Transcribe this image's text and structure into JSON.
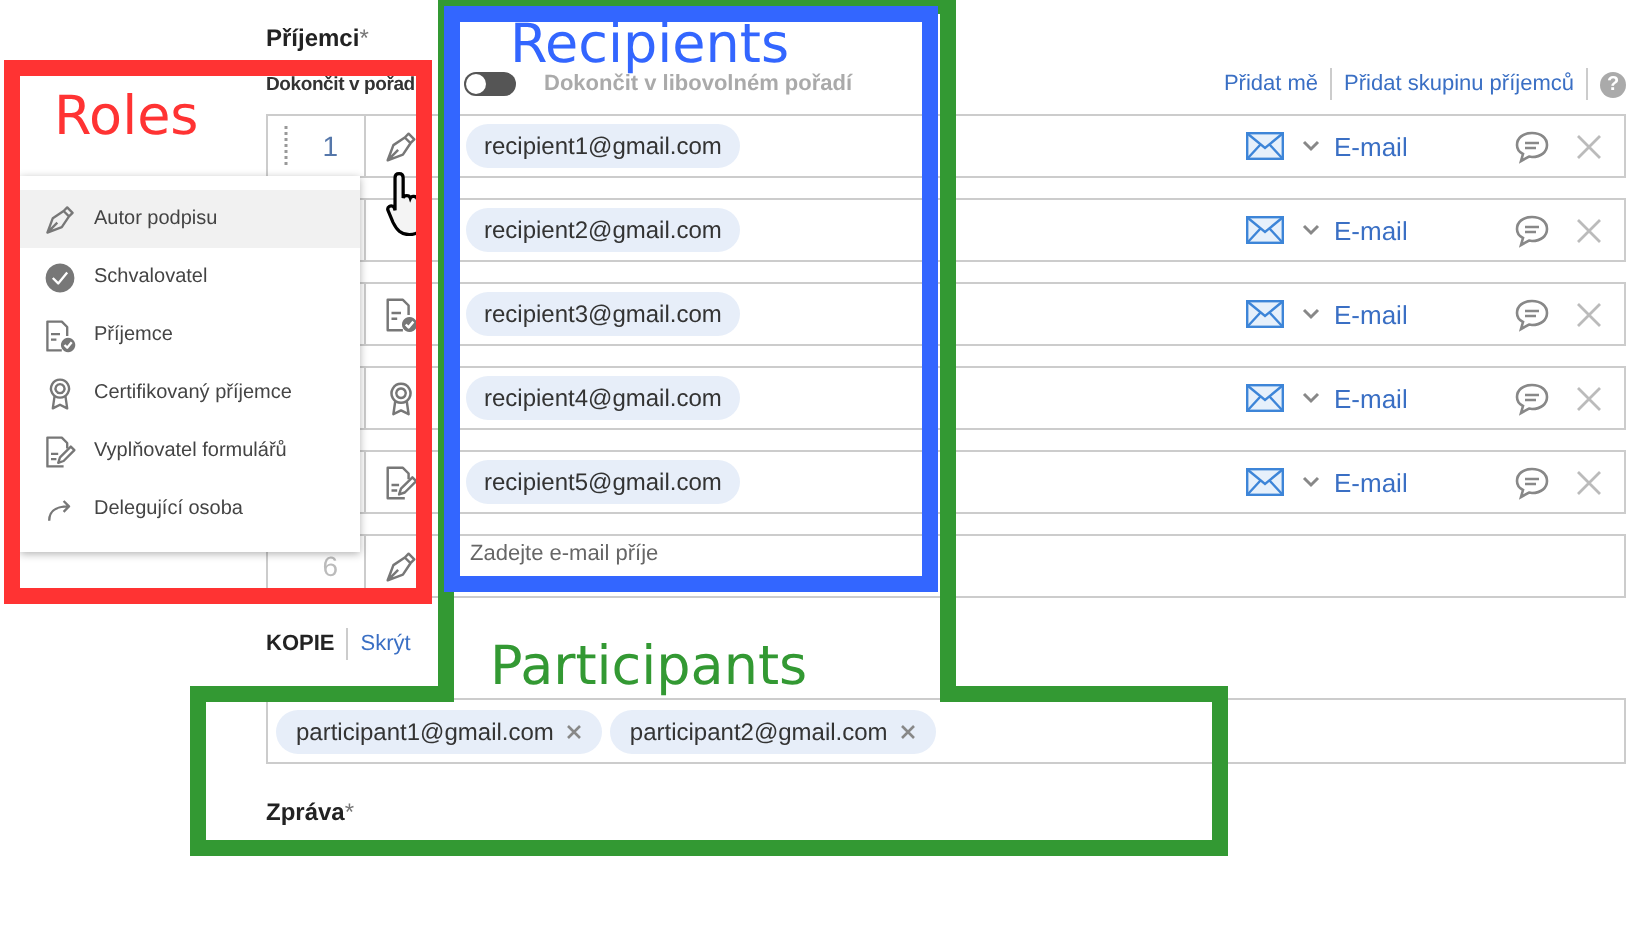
{
  "recipients": {
    "title": "Příjemci",
    "required_mark": "*",
    "order_label": "Dokončit v pořad",
    "order_toggle": {
      "on": false,
      "label": "Dokončit v libovolném pořadí"
    },
    "links": [
      "Přidat mě",
      "Přidat skupinu příjemců"
    ],
    "help": "?",
    "rows": [
      {
        "number": "1",
        "kind": "signer",
        "email": "recipient1@gmail.com",
        "delivery": "E-mail"
      },
      {
        "email": "recipient2@gmail.com",
        "delivery": "E-mail"
      },
      {
        "kind": "recipient",
        "email": "recipient3@gmail.com",
        "delivery": "E-mail"
      },
      {
        "kind": "certified",
        "email": "recipient4@gmail.com",
        "delivery": "E-mail"
      },
      {
        "kind": "form_filler",
        "email": "recipient5@gmail.com",
        "delivery": "E-mail"
      },
      {
        "number": "6",
        "kind": "signer",
        "placeholder": "Zadejte e-mail příje"
      }
    ]
  },
  "roles_menu": {
    "items": [
      {
        "kind": "signer",
        "label": "Autor podpisu",
        "selected": true
      },
      {
        "kind": "approver",
        "label": "Schvalovatel",
        "selected": false
      },
      {
        "kind": "recipient",
        "label": "Příjemce",
        "selected": false
      },
      {
        "kind": "certified",
        "label": "Certifikovaný příjemce",
        "selected": false
      },
      {
        "kind": "form_filler",
        "label": "Vyplňovatel formulářů",
        "selected": false
      },
      {
        "kind": "delegator",
        "label": "Delegující osoba",
        "selected": false
      }
    ]
  },
  "cc": {
    "label": "KOPIE",
    "toggle_link": "Skrýt",
    "participants": [
      "participant1@gmail.com",
      "participant2@gmail.com"
    ]
  },
  "message": {
    "label": "Zpráva",
    "required_mark": "*"
  },
  "annotations": [
    {
      "kind": "roles",
      "label": "Roles",
      "color": "#ff3333"
    },
    {
      "kind": "recipients",
      "label": "Recipients",
      "color": "#3366ff"
    },
    {
      "kind": "participants",
      "label": "Participants",
      "color": "#339933"
    }
  ]
}
